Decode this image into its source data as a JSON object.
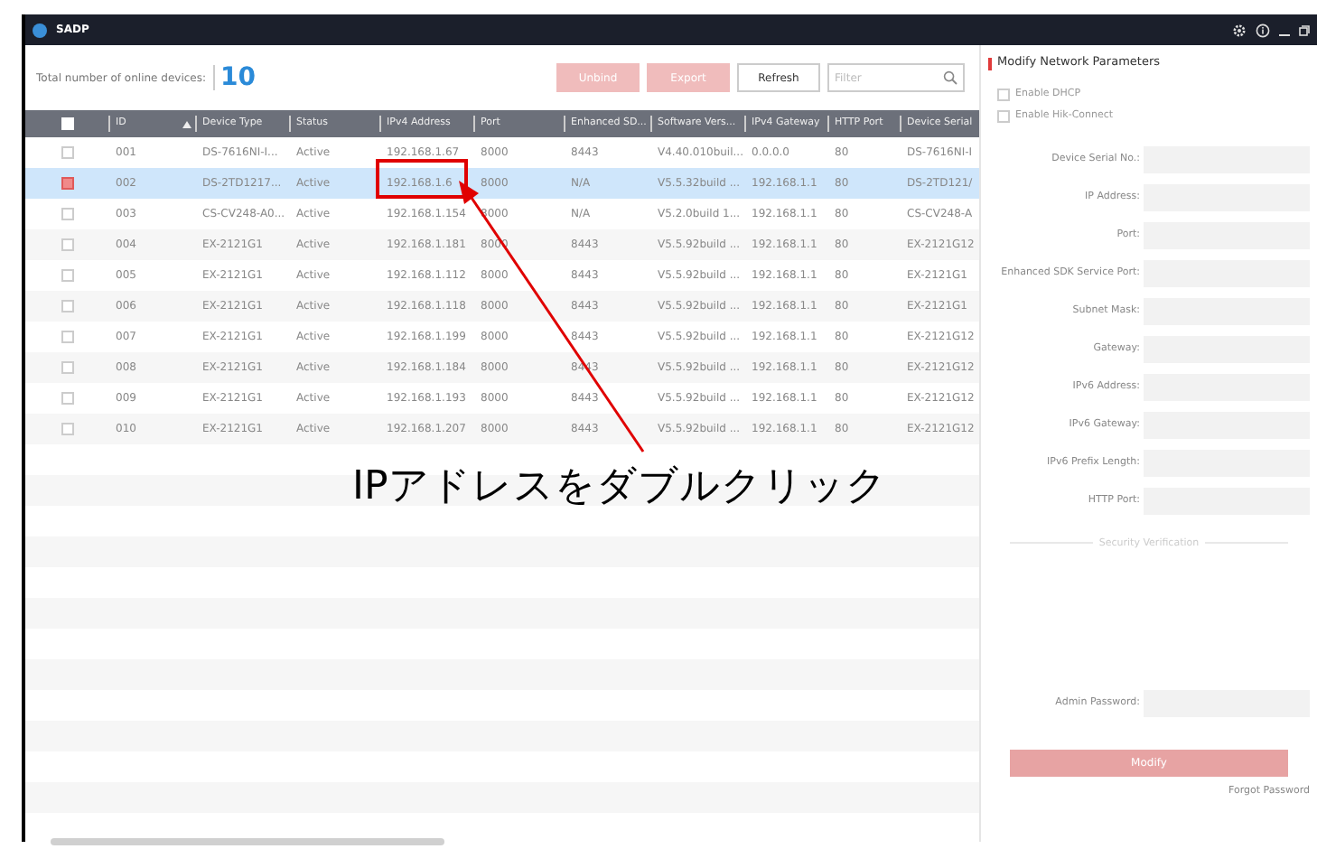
{
  "window": {
    "title": "SADP"
  },
  "toolbar": {
    "count_label": "Total number of online devices:",
    "count": "10",
    "buttons": [
      {
        "label": "Unbind",
        "disabled": true
      },
      {
        "label": "Export",
        "disabled": true
      },
      {
        "label": "Refresh",
        "disabled": false
      }
    ],
    "filter": {
      "placeholder": "Filter"
    }
  },
  "table": {
    "header_checked": false,
    "columns": [
      "ID",
      "Device Type",
      "Status",
      "IPv4 Address",
      "Port",
      "Enhanced SD...",
      "Software Vers...",
      "IPv4 Gateway",
      "HTTP Port",
      "Device Serial"
    ],
    "rows": [
      {
        "selected": false,
        "checked": false,
        "cells": [
          "001",
          "DS-7616NI-I...",
          "Active",
          "192.168.1.67",
          "8000",
          "8443",
          "V4.40.010buil...",
          "0.0.0.0",
          "80",
          "DS-7616NI-I"
        ]
      },
      {
        "selected": true,
        "checked": true,
        "cells": [
          "002",
          "DS-2TD1217...",
          "Active",
          "192.168.1.6",
          "8000",
          "N/A",
          "V5.5.32build ...",
          "192.168.1.1",
          "80",
          "DS-2TD121/"
        ]
      },
      {
        "selected": false,
        "checked": false,
        "cells": [
          "003",
          "CS-CV248-A0...",
          "Active",
          "192.168.1.154",
          "8000",
          "N/A",
          "V5.2.0build 1...",
          "192.168.1.1",
          "80",
          "CS-CV248-A"
        ]
      },
      {
        "selected": false,
        "checked": false,
        "cells": [
          "004",
          "EX-2121G1",
          "Active",
          "192.168.1.181",
          "8000",
          "8443",
          "V5.5.92build ...",
          "192.168.1.1",
          "80",
          "EX-2121G12"
        ]
      },
      {
        "selected": false,
        "checked": false,
        "cells": [
          "005",
          "EX-2121G1",
          "Active",
          "192.168.1.112",
          "8000",
          "8443",
          "V5.5.92build ...",
          "192.168.1.1",
          "80",
          "EX-2121G1"
        ]
      },
      {
        "selected": false,
        "checked": false,
        "cells": [
          "006",
          "EX-2121G1",
          "Active",
          "192.168.1.118",
          "8000",
          "8443",
          "V5.5.92build ...",
          "192.168.1.1",
          "80",
          "EX-2121G1"
        ]
      },
      {
        "selected": false,
        "checked": false,
        "cells": [
          "007",
          "EX-2121G1",
          "Active",
          "192.168.1.199",
          "8000",
          "8443",
          "V5.5.92build ...",
          "192.168.1.1",
          "80",
          "EX-2121G12"
        ]
      },
      {
        "selected": false,
        "checked": false,
        "cells": [
          "008",
          "EX-2121G1",
          "Active",
          "192.168.1.184",
          "8000",
          "8443",
          "V5.5.92build ...",
          "192.168.1.1",
          "80",
          "EX-2121G12"
        ]
      },
      {
        "selected": false,
        "checked": false,
        "cells": [
          "009",
          "EX-2121G1",
          "Active",
          "192.168.1.193",
          "8000",
          "8443",
          "V5.5.92build ...",
          "192.168.1.1",
          "80",
          "EX-2121G12"
        ]
      },
      {
        "selected": false,
        "checked": false,
        "cells": [
          "010",
          "EX-2121G1",
          "Active",
          "192.168.1.207",
          "8000",
          "8443",
          "V5.5.92build ...",
          "192.168.1.1",
          "80",
          "EX-2121G12"
        ]
      }
    ]
  },
  "panel": {
    "title": "Modify Network Parameters",
    "options": [
      {
        "label": "Enable DHCP",
        "checked": false
      },
      {
        "label": "Enable Hik-Connect",
        "checked": false
      }
    ],
    "fields": [
      {
        "label": "Device Serial No.:"
      },
      {
        "label": "IP Address:"
      },
      {
        "label": "Port:"
      },
      {
        "label": "Enhanced SDK Service Port:"
      },
      {
        "label": "Subnet Mask:"
      },
      {
        "label": "Gateway:"
      },
      {
        "label": "IPv6 Address:"
      },
      {
        "label": "IPv6 Gateway:"
      },
      {
        "label": "IPv6 Prefix Length:"
      },
      {
        "label": "HTTP Port:"
      }
    ],
    "security_label": "Security Verification",
    "password_label": "Admin Password:",
    "modify": {
      "label": "Modify",
      "disabled": true
    },
    "forgot": "Forgot Password"
  },
  "annotation": {
    "text": "IPアドレスをダブルクリック"
  }
}
